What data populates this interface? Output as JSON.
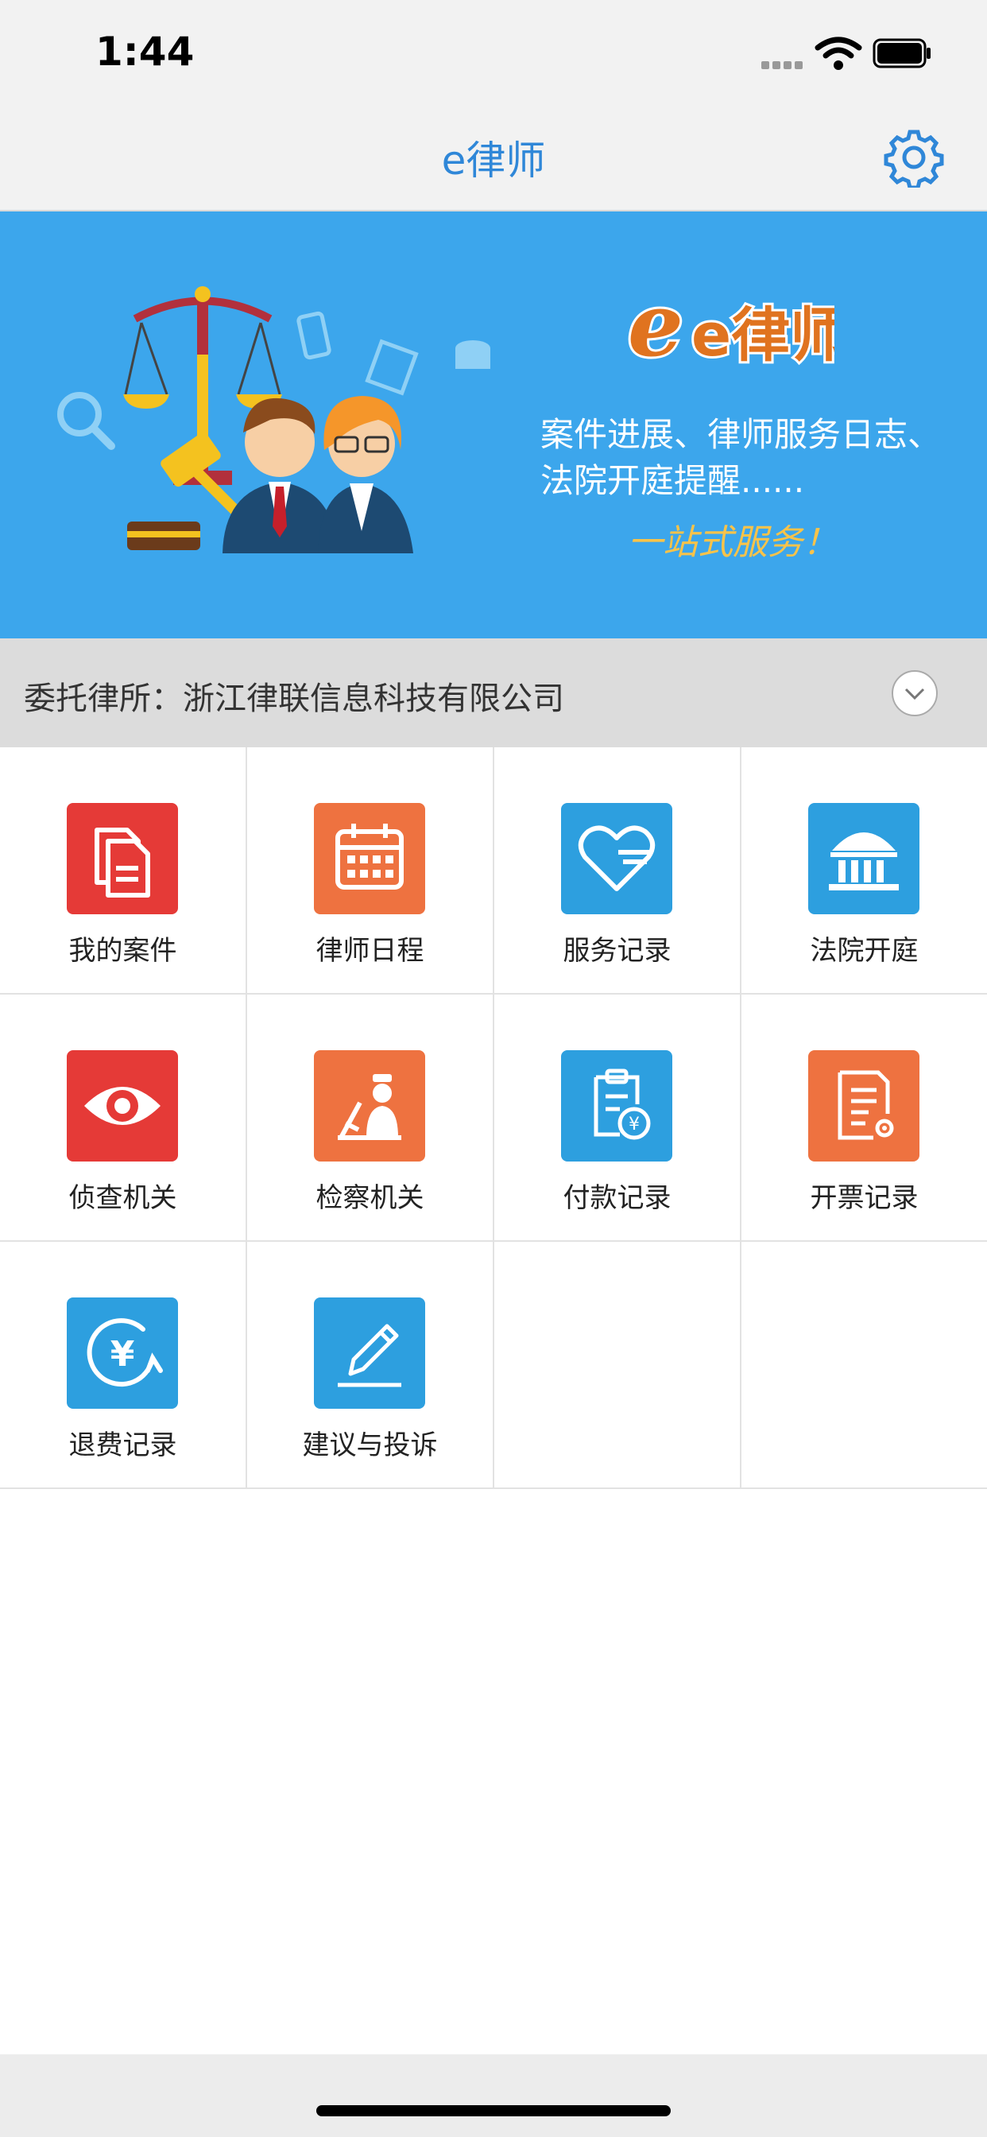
{
  "status": {
    "time": "1:44"
  },
  "nav": {
    "title": "e律师"
  },
  "banner": {
    "logo": "e律师",
    "tagline_line1": "案件进展、律师服务日志、",
    "tagline_line2": "法院开庭提醒......",
    "slogan": "一站式服务！"
  },
  "firm": {
    "label": "委托律所：浙江律联信息科技有限公司"
  },
  "menu": [
    {
      "label": "我的案件",
      "icon": "document-copy-icon",
      "color": "#e53a37"
    },
    {
      "label": "律师日程",
      "icon": "calendar-icon",
      "color": "#ee7240"
    },
    {
      "label": "服务记录",
      "icon": "heart-icon",
      "color": "#2d9fdf"
    },
    {
      "label": "法院开庭",
      "icon": "courthouse-icon",
      "color": "#2d9fdf"
    },
    {
      "label": "侦查机关",
      "icon": "eye-icon",
      "color": "#e53a37"
    },
    {
      "label": "检察机关",
      "icon": "prosecutor-icon",
      "color": "#ee7240"
    },
    {
      "label": "付款记录",
      "icon": "clipboard-yen-icon",
      "color": "#2d9fdf"
    },
    {
      "label": "开票记录",
      "icon": "invoice-gear-icon",
      "color": "#ee7240"
    },
    {
      "label": "退费记录",
      "icon": "refund-yen-icon",
      "color": "#2d9fdf"
    },
    {
      "label": "建议与投诉",
      "icon": "pencil-icon",
      "color": "#2d9fdf"
    }
  ]
}
